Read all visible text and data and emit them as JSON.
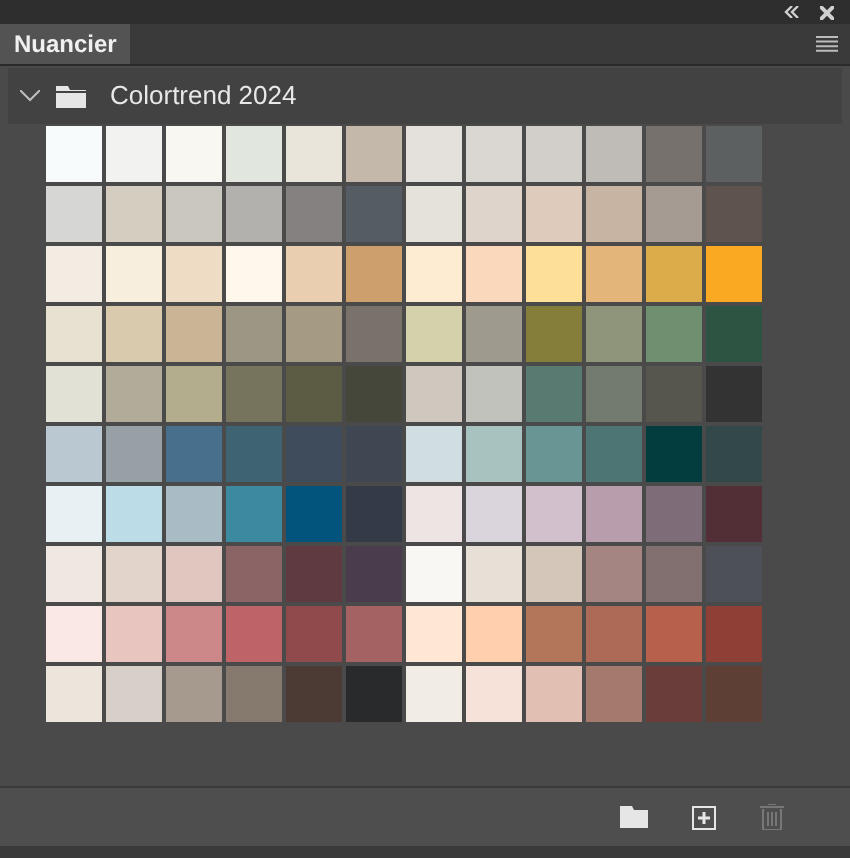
{
  "panel": {
    "tab": "Nuancier",
    "tab_selected": true
  },
  "group": {
    "name": "Colortrend 2024",
    "expanded": true,
    "rows": [
      [
        {
          "color": "#f8fbfc"
        },
        {
          "color": "#f2f2f0"
        },
        {
          "color": "#f8f7f2"
        },
        {
          "color": "#e1e6df"
        },
        {
          "color": "#e9e5da"
        },
        {
          "color": "#c3b8aa"
        },
        {
          "color": "#e4e0dc"
        },
        {
          "color": "#dad6d2"
        },
        {
          "color": "#d2cfcb"
        },
        {
          "color": "#bfbbb7"
        },
        {
          "color": "#76716c"
        },
        {
          "color": "#5d6060"
        }
      ],
      [
        {
          "color": "#d6d6d4"
        },
        {
          "color": "#d6cdc1"
        },
        {
          "color": "#cac7c1"
        },
        {
          "color": "#b3b1ad"
        },
        {
          "color": "#858180"
        },
        {
          "color": "#565c64"
        },
        {
          "color": "#e5e2dc"
        },
        {
          "color": "#ded4cb"
        },
        {
          "color": "#dfcbbb"
        },
        {
          "color": "#c8b4a3"
        },
        {
          "color": "#a59b93"
        },
        {
          "color": "#5e534f"
        }
      ],
      [
        {
          "color": "#f3ece2"
        },
        {
          "color": "#f7eedd"
        },
        {
          "color": "#efdcc4"
        },
        {
          "color": "#fdf8eb"
        },
        {
          "color": "#e9cfb0"
        },
        {
          "color": "#cd9f6c"
        },
        {
          "color": "#fdebd2"
        },
        {
          "color": "#f9d8bb"
        },
        {
          "color": "#fedf98"
        },
        {
          "color": "#e3b57a"
        },
        {
          "color": "#dcab4a"
        },
        {
          "color": "#faa922"
        }
      ],
      [
        {
          "color": "#e8e0d0"
        },
        {
          "color": "#d9c9ad"
        },
        {
          "color": "#cbb496"
        },
        {
          "color": "#9c9684"
        },
        {
          "color": "#a59a84"
        },
        {
          "color": "#79726a"
        },
        {
          "color": "#d5d2ab"
        },
        {
          "color": "#9f9a8e"
        },
        {
          "color": "#857e3a"
        },
        {
          "color": "#8f957b"
        },
        {
          "color": "#6e9070"
        },
        {
          "color": "#2d5343"
        }
      ],
      [
        {
          "color": "#e1e1d5"
        },
        {
          "color": "#b3ab9a"
        },
        {
          "color": "#b3ac8d"
        },
        {
          "color": "#76745d"
        },
        {
          "color": "#5c5c44"
        },
        {
          "color": "#46473b"
        },
        {
          "color": "#d0c8bf"
        },
        {
          "color": "#c1c2bc"
        },
        {
          "color": "#597a71"
        },
        {
          "color": "#727b6e"
        },
        {
          "color": "#56564f"
        },
        {
          "color": "#333333"
        }
      ],
      [
        {
          "color": "#bac9d1"
        },
        {
          "color": "#97a0a5"
        },
        {
          "color": "#48708c"
        },
        {
          "color": "#3e6474"
        },
        {
          "color": "#3e4c5c"
        },
        {
          "color": "#3f4852"
        },
        {
          "color": "#d0dde1"
        },
        {
          "color": "#a8c2bf"
        },
        {
          "color": "#6a9595"
        },
        {
          "color": "#4c7574"
        },
        {
          "color": "#033d3e"
        },
        {
          "color": "#334849"
        }
      ],
      [
        {
          "color": "#e7f0f2"
        },
        {
          "color": "#bcdde8"
        },
        {
          "color": "#a9bbc4"
        },
        {
          "color": "#3c8aa0"
        },
        {
          "color": "#03547c"
        },
        {
          "color": "#353a49"
        },
        {
          "color": "#ede4e3"
        },
        {
          "color": "#dad4dc"
        },
        {
          "color": "#d3c0cd"
        },
        {
          "color": "#b89dad"
        },
        {
          "color": "#7e6d78"
        },
        {
          "color": "#522f37"
        }
      ],
      [
        {
          "color": "#efe7e2"
        },
        {
          "color": "#e2d4cb"
        },
        {
          "color": "#dfc6be"
        },
        {
          "color": "#8b6466"
        },
        {
          "color": "#5f3a40"
        },
        {
          "color": "#4a3c4d"
        },
        {
          "color": "#f9f7f4"
        },
        {
          "color": "#e6e0d6"
        },
        {
          "color": "#d4c6b9"
        },
        {
          "color": "#a48582"
        },
        {
          "color": "#826f6f"
        },
        {
          "color": "#4d5056"
        }
      ],
      [
        {
          "color": "#f9e8e3"
        },
        {
          "color": "#e8c5be"
        },
        {
          "color": "#cc8788"
        },
        {
          "color": "#be6466"
        },
        {
          "color": "#904a4c"
        },
        {
          "color": "#a56263"
        },
        {
          "color": "#fee7d5"
        },
        {
          "color": "#ffcfae"
        },
        {
          "color": "#b3765b"
        },
        {
          "color": "#ad6a57"
        },
        {
          "color": "#b7614d"
        },
        {
          "color": "#8e4037"
        }
      ],
      [
        {
          "color": "#ebe5dc"
        },
        {
          "color": "#d7d0c8"
        },
        {
          "color": "#a59a8d"
        },
        {
          "color": "#86796e"
        },
        {
          "color": "#4b3b34"
        },
        {
          "color": "#282a2c"
        },
        {
          "color": "#f1ece4"
        },
        {
          "color": "#f7e2d9"
        },
        {
          "color": "#e1bfb3"
        },
        {
          "color": "#a37a6d"
        },
        {
          "color": "#6b3d3a"
        },
        {
          "color": "#5e3f36"
        }
      ]
    ]
  },
  "footer": {
    "delete_disabled": true
  }
}
